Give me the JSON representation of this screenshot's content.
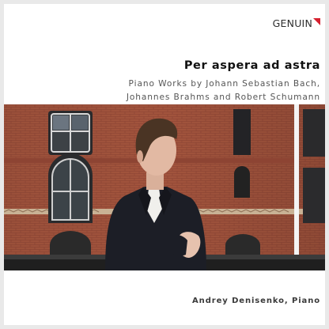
{
  "album": {
    "label_logo": "GENUIN",
    "title": "Per aspera ad astra",
    "subtitle_lines": [
      "Piano Works by Johann Sebastian Bach,",
      "Johannes Brahms and Robert Schumann"
    ],
    "artist_credit": "Andrey Denisenko, Piano"
  },
  "colors": {
    "logo_accent": "#d6202f",
    "brick": "#a0503a",
    "background": "#ffffff"
  }
}
